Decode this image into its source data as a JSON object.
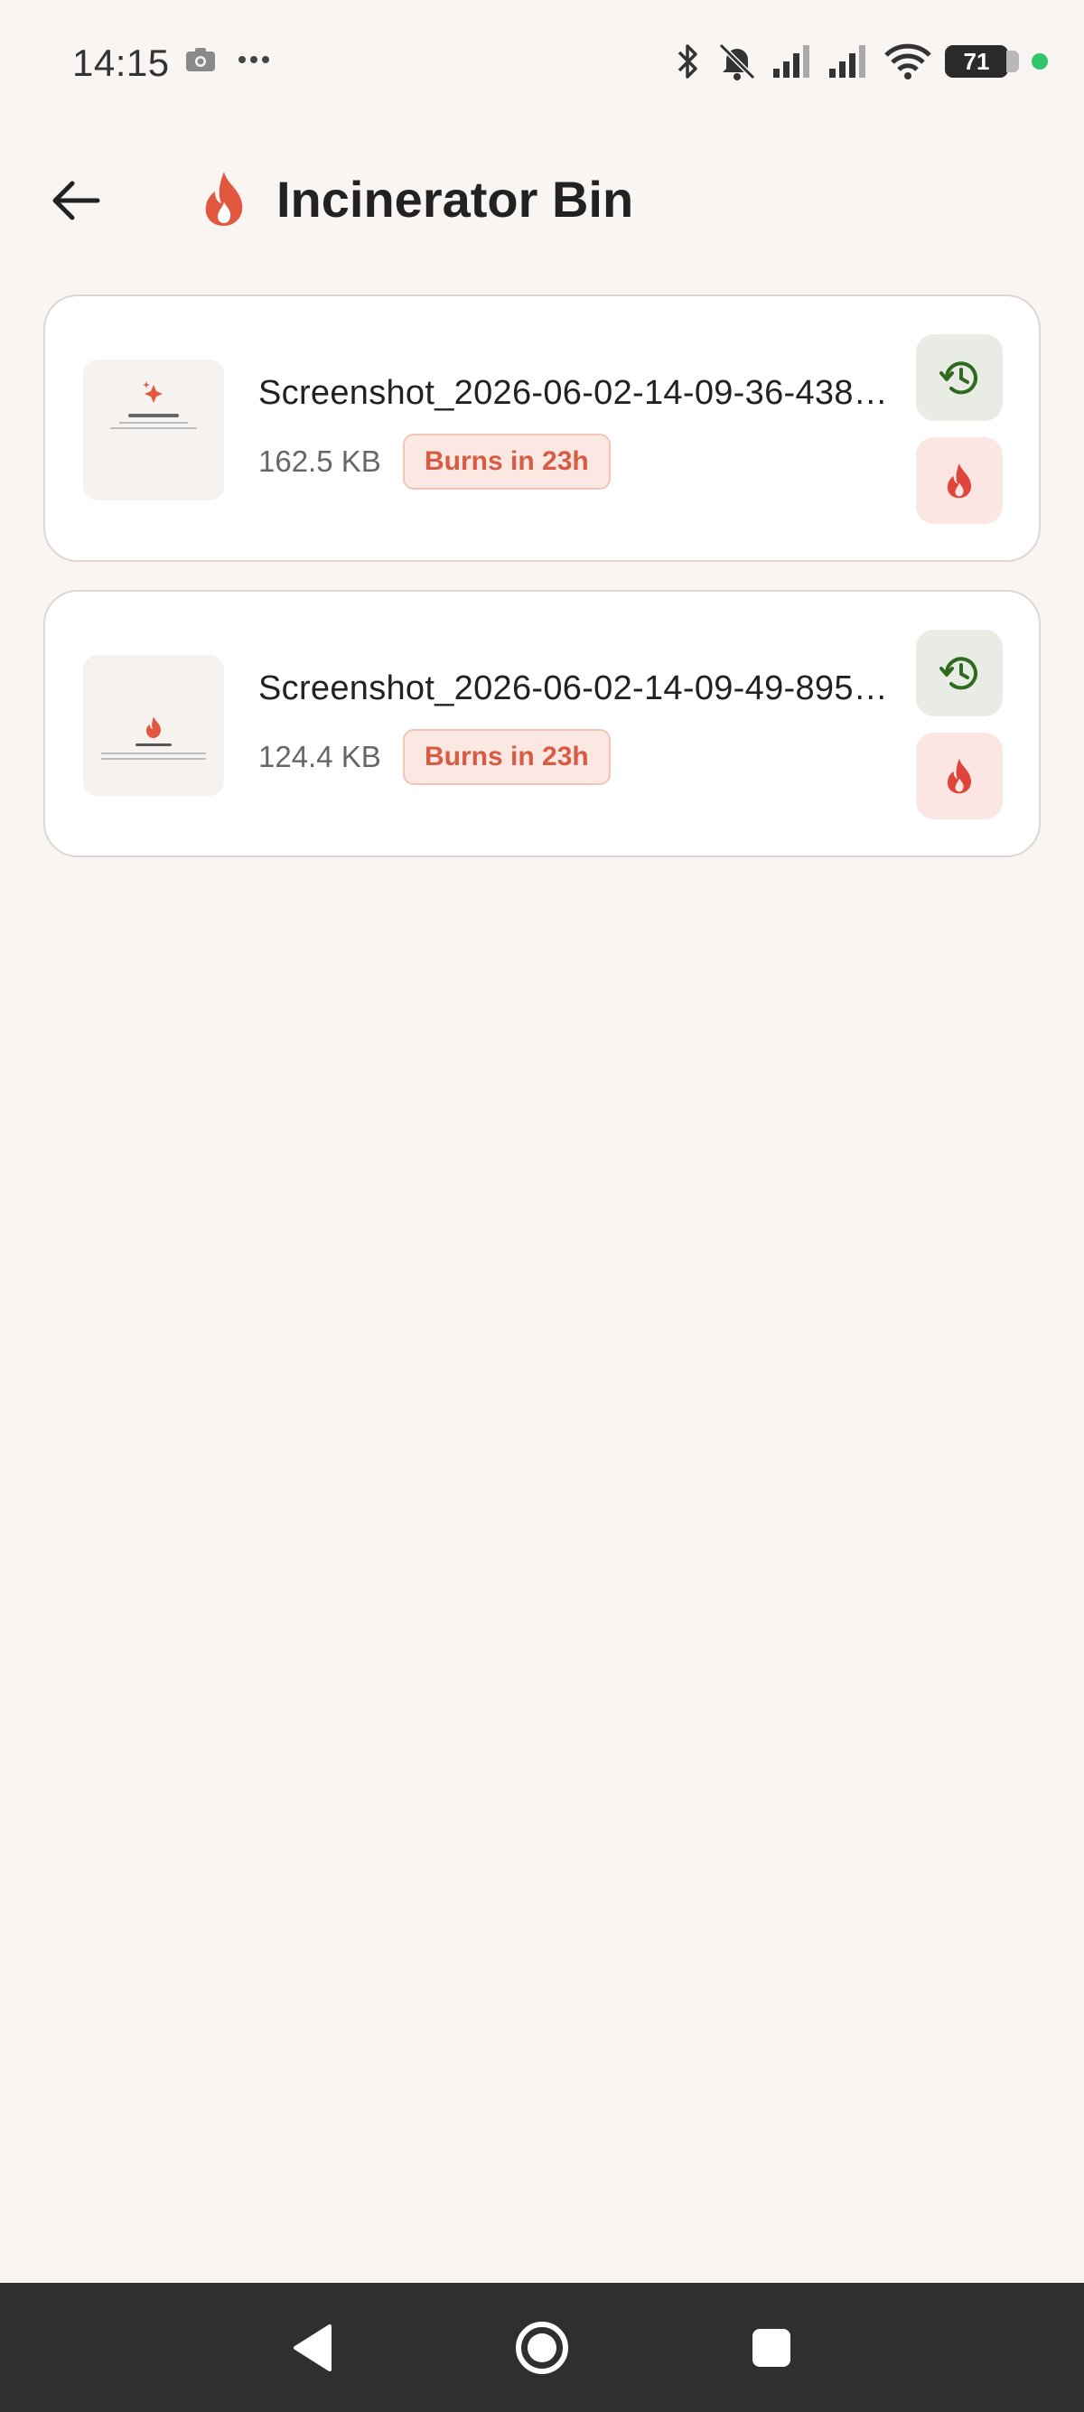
{
  "status_bar": {
    "time": "14:15",
    "battery": "71",
    "icons": [
      "camera-icon",
      "more-dots-icon",
      "bluetooth-icon",
      "bell-off-icon",
      "signal-icon",
      "signal-icon",
      "wifi-icon",
      "battery-icon"
    ]
  },
  "header": {
    "title": "Incinerator Bin",
    "back_icon": "arrow-left-icon",
    "title_icon": "flame-icon"
  },
  "items": [
    {
      "file_name": "Screenshot_2026-06-02-14-09-36-438…",
      "size": "162.5 KB",
      "badge": "Burns in 23h",
      "thumb_caption": "Gallery is clean"
    },
    {
      "file_name": "Screenshot_2026-06-02-14-09-49-895…",
      "size": "124.4 KB",
      "badge": "Burns in 23h",
      "thumb_caption": "Bin is empty"
    }
  ],
  "colors": {
    "accent_flame": "#e2583e",
    "restore_green": "#2f6b1e",
    "badge_text": "#d85b44",
    "background": "#f9f5f3"
  },
  "nav": {
    "back": "nav-back-icon",
    "home": "nav-home-icon",
    "recents": "nav-recents-icon"
  }
}
